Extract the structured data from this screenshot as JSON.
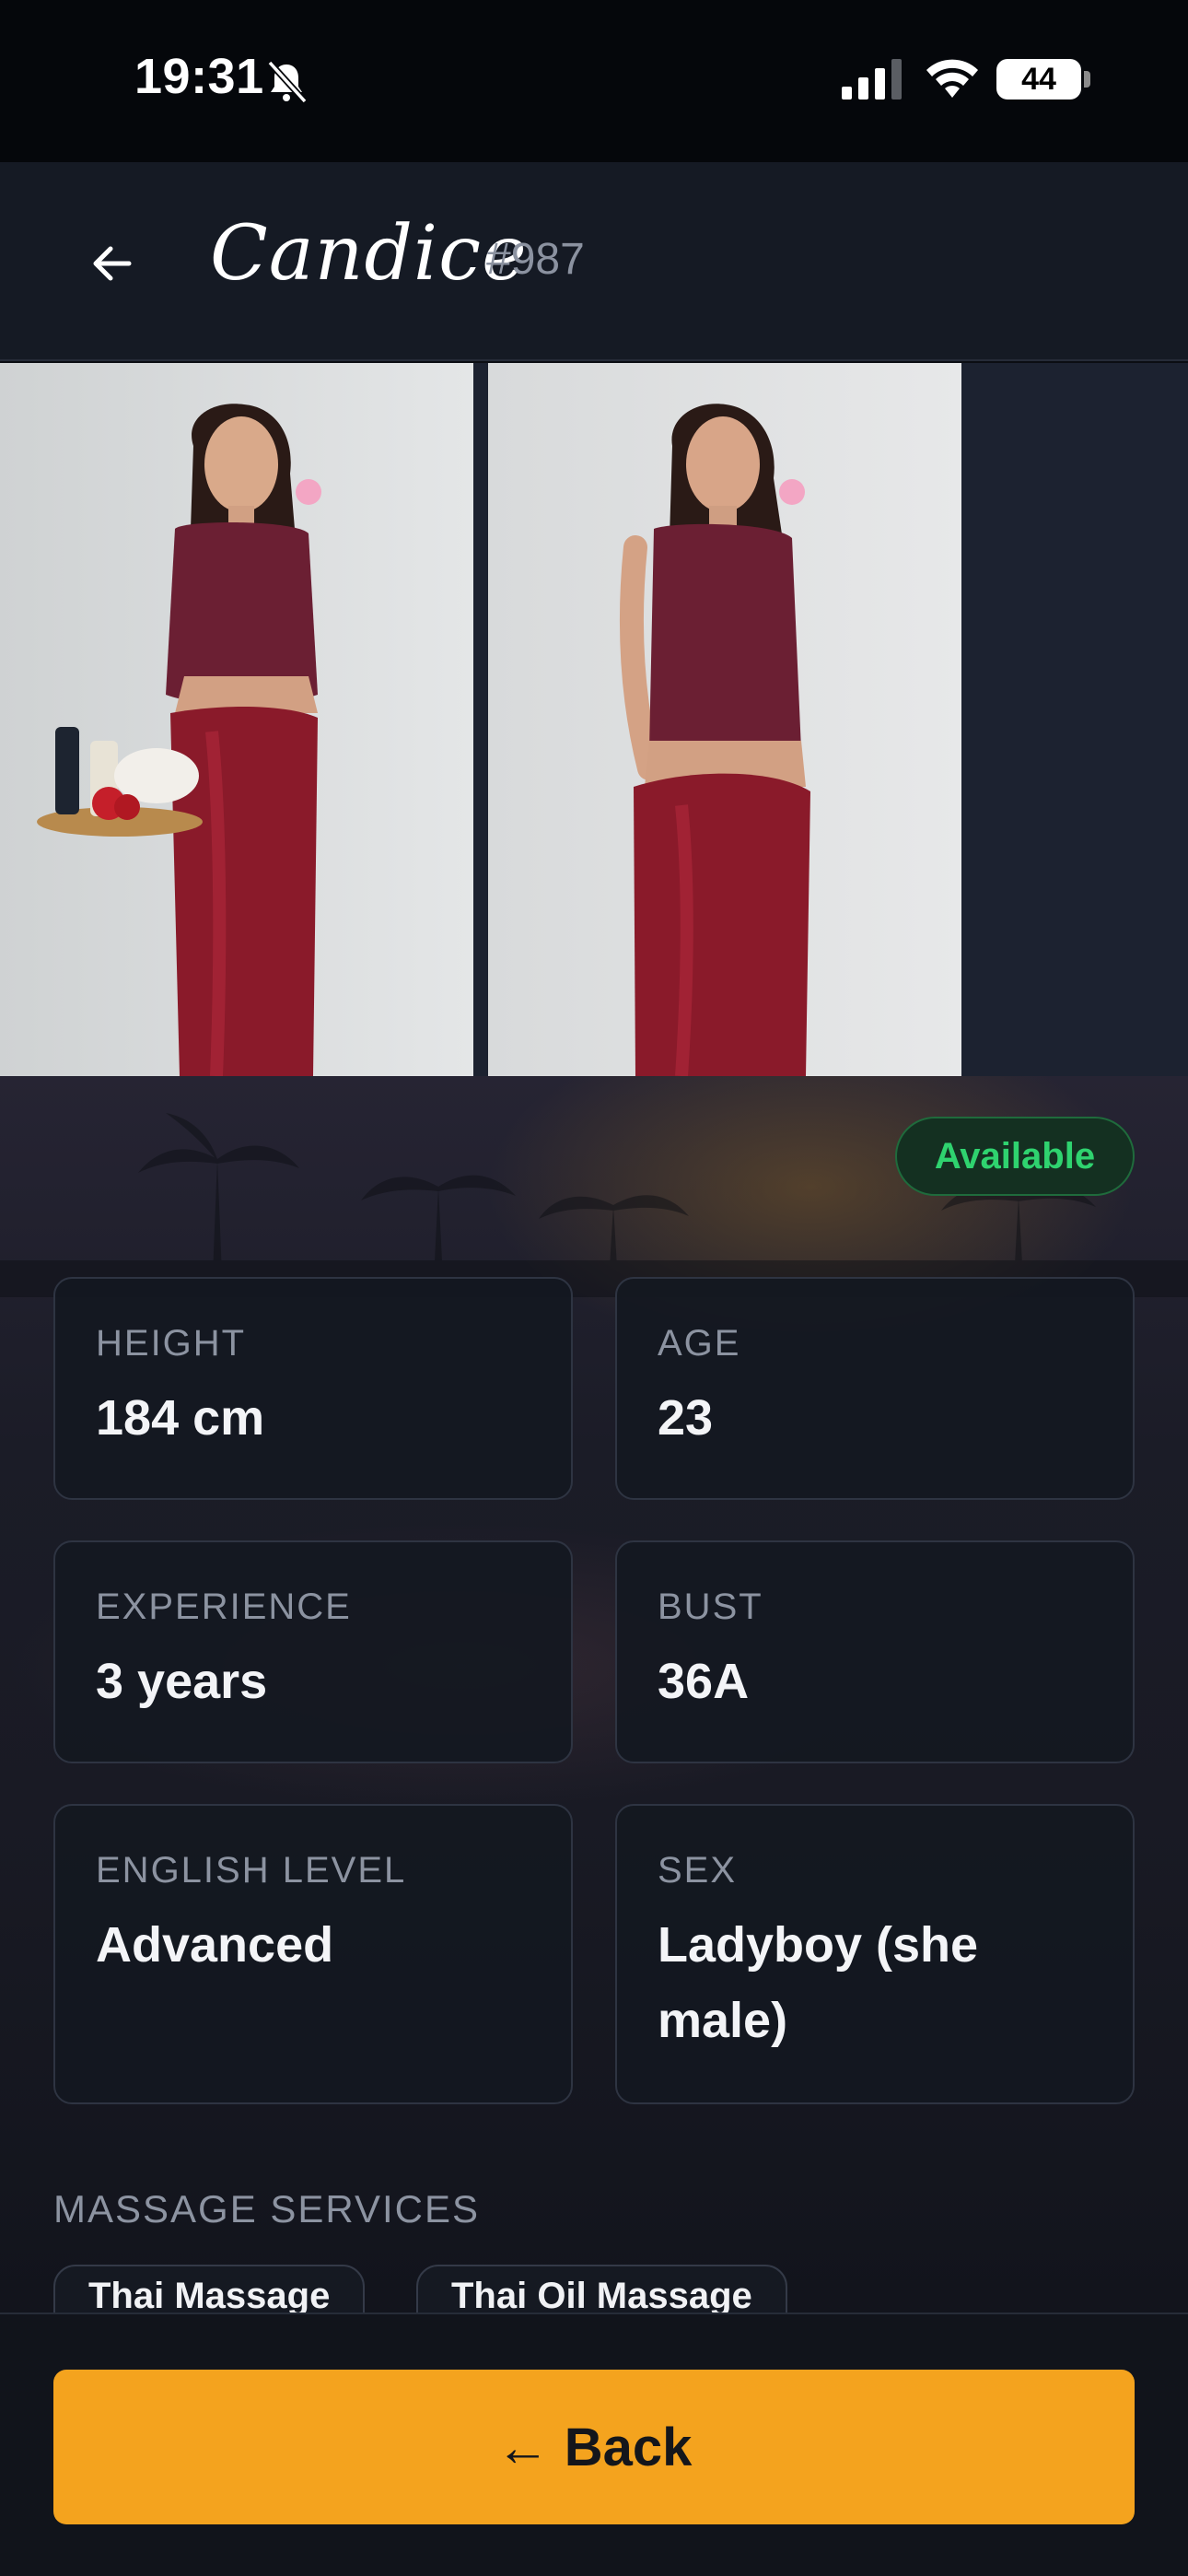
{
  "status_bar": {
    "time": "19:31",
    "battery": "44",
    "battery_level": 0.44
  },
  "header": {
    "name": "Candice",
    "id": "#987"
  },
  "status_badge": "Available",
  "stats": [
    {
      "label": "HEIGHT",
      "value": "184 cm"
    },
    {
      "label": "AGE",
      "value": "23"
    },
    {
      "label": "EXPERIENCE",
      "value": "3 years"
    },
    {
      "label": "BUST",
      "value": "36A"
    },
    {
      "label": "ENGLISH LEVEL",
      "value": "Advanced"
    },
    {
      "label": "SEX",
      "value": "Ladyboy (she male)"
    }
  ],
  "services": {
    "title": "MASSAGE SERVICES",
    "items": [
      "Thai Massage",
      "Thai Oil Massage"
    ]
  },
  "footer": {
    "back_label": "← Back"
  },
  "colors": {
    "accent": "#f4a31e",
    "available": "#2fd36f",
    "background": "#151a24"
  }
}
